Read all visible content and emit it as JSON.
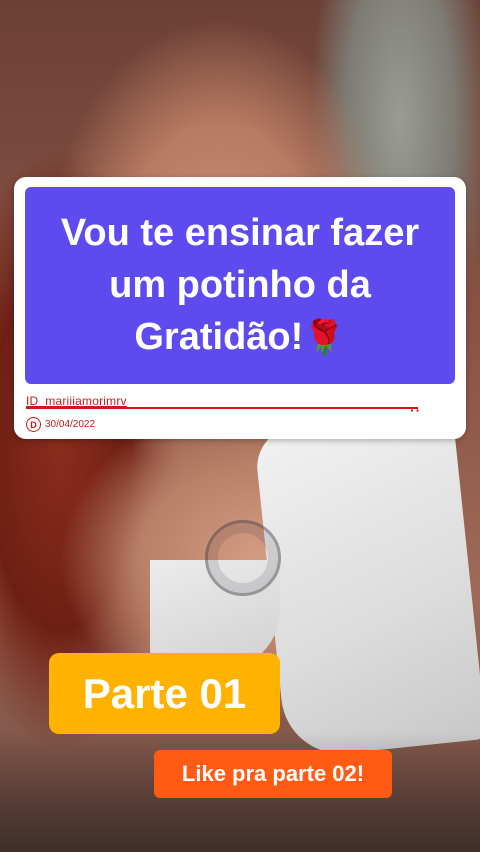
{
  "title_card": {
    "line1": "Vou te ensinar fazer",
    "line2": "um potinho da",
    "line3": "Gratidão!",
    "emoji": "🌹",
    "user_id": "ID_mariiiamorimrv",
    "badge_letter": "D",
    "date": "30/04/2022"
  },
  "part_badge": {
    "label": "Parte 01"
  },
  "like_button": {
    "label": "Like pra parte 02!"
  },
  "colors": {
    "title_bg": "#5e4bf0",
    "part_bg": "#ffb300",
    "like_bg": "#ff5b14",
    "accent_red": "#c81a1a"
  }
}
